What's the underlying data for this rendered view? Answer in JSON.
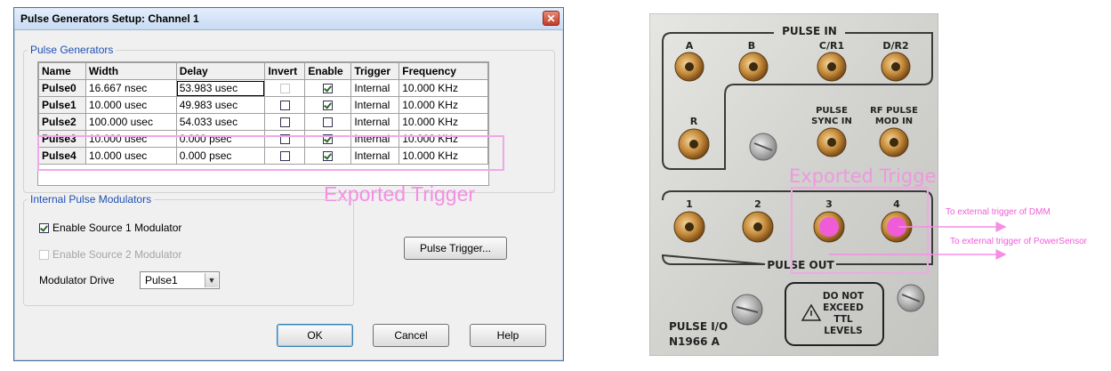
{
  "dialog": {
    "title": "Pulse Generators Setup: Channel 1",
    "close_glyph": "✕",
    "pulse_group_title": "Pulse Generators",
    "table": {
      "headers": [
        "Name",
        "Width",
        "Delay",
        "Invert",
        "Enable",
        "Trigger",
        "Frequency"
      ],
      "rows": [
        {
          "name": "Pulse0",
          "width": "16.667 nsec",
          "delay": "53.983 usec",
          "invert": false,
          "enable": true,
          "trigger": "Internal",
          "frequency": "10.000 KHz"
        },
        {
          "name": "Pulse1",
          "width": "10.000 usec",
          "delay": "49.983 usec",
          "invert": false,
          "enable": true,
          "trigger": "Internal",
          "frequency": "10.000 KHz"
        },
        {
          "name": "Pulse2",
          "width": "100.000 usec",
          "delay": "54.033 usec",
          "invert": false,
          "enable": false,
          "trigger": "Internal",
          "frequency": "10.000 KHz"
        },
        {
          "name": "Pulse3",
          "width": "10.000 usec",
          "delay": "0.000 psec",
          "invert": false,
          "enable": true,
          "trigger": "Internal",
          "frequency": "10.000 KHz"
        },
        {
          "name": "Pulse4",
          "width": "10.000 usec",
          "delay": "0.000 psec",
          "invert": false,
          "enable": true,
          "trigger": "Internal",
          "frequency": "10.000 KHz"
        }
      ]
    },
    "modulators": {
      "group_title": "Internal Pulse Modulators",
      "source1_label": "Enable Source 1 Modulator",
      "source1_checked": true,
      "source2_label": "Enable Source 2 Modulator",
      "source2_checked": false,
      "drive_label": "Modulator Drive",
      "drive_value": "Pulse1"
    },
    "buttons": {
      "pulse_trigger": "Pulse Trigger...",
      "ok": "OK",
      "cancel": "Cancel",
      "help": "Help"
    },
    "annotation": "Exported Trigger"
  },
  "panel": {
    "pulse_in_title": "PULSE IN",
    "inputs": [
      "A",
      "B",
      "C/R1",
      "D/R2"
    ],
    "r_label": "R",
    "pulse_sync_in": [
      "PULSE",
      "SYNC IN"
    ],
    "rf_pulse_mod_in": [
      "RF PULSE",
      "MOD IN"
    ],
    "outputs": [
      "1",
      "2",
      "3",
      "4"
    ],
    "pulse_out_title": "PULSE OUT",
    "warning": [
      "DO NOT",
      "EXCEED",
      "TTL",
      "LEVELS"
    ],
    "model": [
      "PULSE I/O",
      "N1966 A"
    ],
    "annotation": "Exported Trigger",
    "arrow_dmm": "To external trigger of DMM",
    "arrow_power": "To external trigger of PowerSensor"
  },
  "colors": {
    "annotation_pink": "#f58ee4",
    "marker_pink": "#f05cd8",
    "legend_blue": "#1f4fb1"
  }
}
